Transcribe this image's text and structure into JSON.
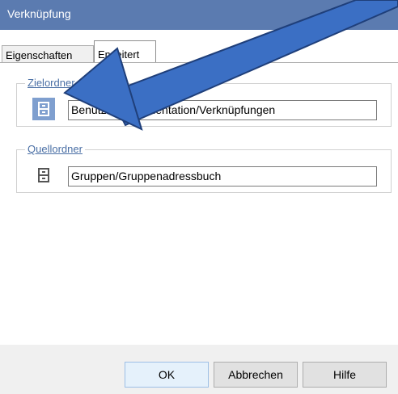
{
  "window": {
    "title": "Verknüpfung"
  },
  "tabs": [
    {
      "label": "Eigenschaften"
    },
    {
      "label": "Erweitert"
    }
  ],
  "target_group": {
    "legend": "Zielordner",
    "value": "Benutzer/Dokumentation/Verknüpfungen",
    "icon": "folder-cabinet-icon"
  },
  "source_group": {
    "legend": "Quellordner",
    "value": "Gruppen/Gruppenadressbuch",
    "icon": "folder-cabinet-icon"
  },
  "buttons": {
    "ok": "OK",
    "cancel": "Abbrechen",
    "help": "Hilfe"
  },
  "annotation": {
    "color": "#3b6fc4",
    "type": "arrow"
  }
}
